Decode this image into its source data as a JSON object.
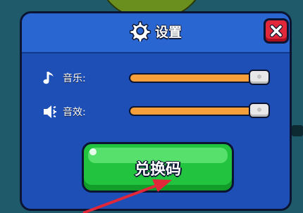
{
  "dialog": {
    "title": "设置",
    "title_icon": "gear-icon",
    "close_icon": "close-icon"
  },
  "settings": {
    "music": {
      "label": "音乐:",
      "icon": "music-note-icon",
      "level": 1.0
    },
    "sound": {
      "label": "音效:",
      "icon": "speaker-icon",
      "level": 1.0
    }
  },
  "redeem_button": {
    "label": "兑换码"
  },
  "colors": {
    "panel": "#1d4fb6",
    "title_bar": "#2a66d2",
    "slider_fill": "#f7a03b",
    "button_green": "#22c33e",
    "close_red": "#e0283a",
    "arrow_red": "#e0283a"
  },
  "annotation": {
    "arrow_icon": "red-arrow-icon"
  }
}
